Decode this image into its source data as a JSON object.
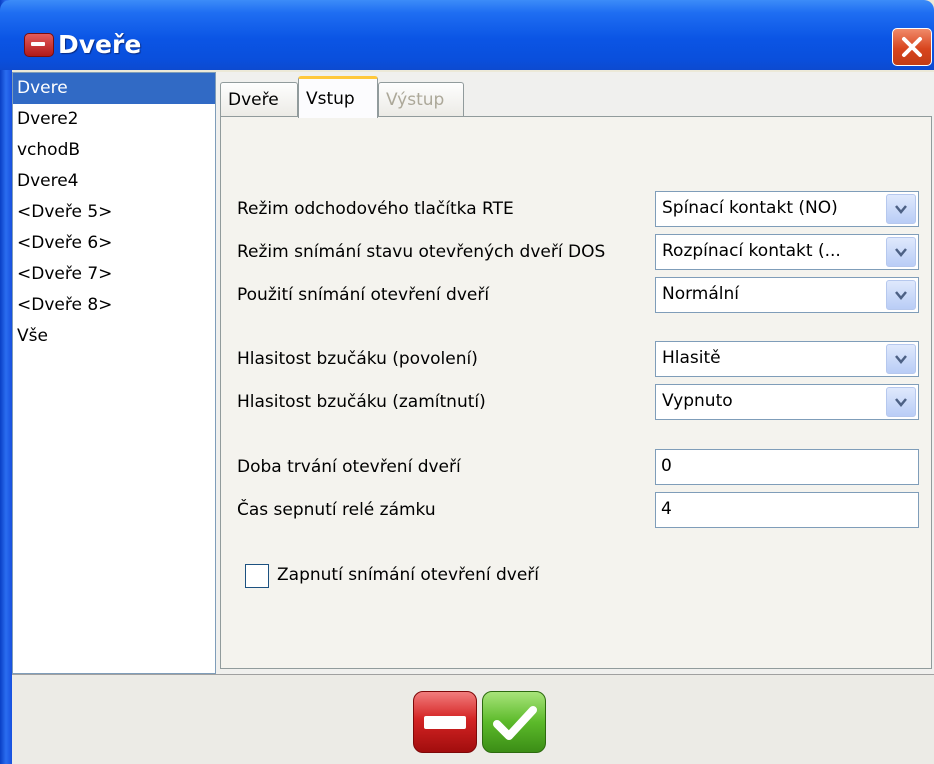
{
  "window": {
    "title": "Dveře"
  },
  "sidebar": {
    "items": [
      {
        "label": "Dvere",
        "selected": true
      },
      {
        "label": "Dvere2"
      },
      {
        "label": "vchodB"
      },
      {
        "label": "Dvere4"
      },
      {
        "label": "<Dveře 5>"
      },
      {
        "label": "<Dveře 6>"
      },
      {
        "label": "<Dveře 7>"
      },
      {
        "label": "<Dveře 8>"
      },
      {
        "label": "Vše"
      }
    ]
  },
  "tabs": [
    {
      "label": "Dveře"
    },
    {
      "label": "Vstup",
      "active": true
    },
    {
      "label": "Výstup",
      "disabled": true
    }
  ],
  "settings": {
    "rte": {
      "label": "Režim odchodového tlačítka RTE",
      "value": "Spínací kontakt (NO)"
    },
    "dos": {
      "label": "Režim snímání stavu otevřených dveří DOS",
      "value": "Rozpínací kontakt (..."
    },
    "sensing": {
      "label": "Použití snímání otevření dveří",
      "value": "Normální"
    },
    "buzzer_allow": {
      "label": "Hlasitost bzučáku (povolení)",
      "value": "Hlasitě"
    },
    "buzzer_deny": {
      "label": "Hlasitost bzučáku (zamítnutí)",
      "value": "Vypnuto"
    },
    "open_duration": {
      "label": "Doba trvání otevření dveří",
      "value": "0"
    },
    "relay_time": {
      "label": "Čas sepnutí relé zámku",
      "value": "4"
    },
    "enable_sensing": {
      "label": "Zapnutí snímání otevření dveří",
      "checked": false
    }
  },
  "colors": {
    "title_bar": "#0b55e5",
    "selection": "#316ac5",
    "cancel": "#d42424",
    "ok": "#5cba2a"
  }
}
